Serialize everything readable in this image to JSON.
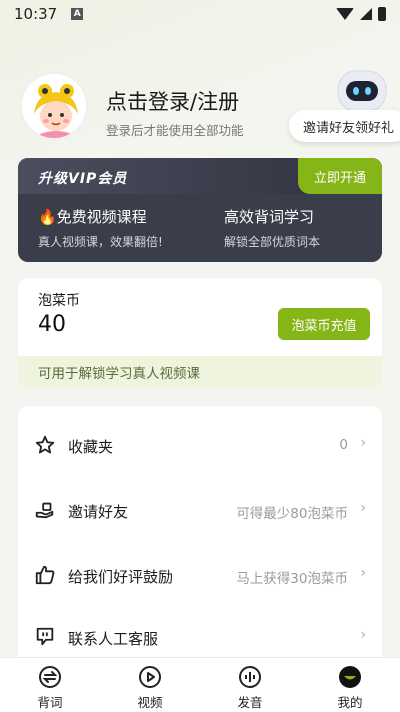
{
  "status_bar": {
    "time": "10:37",
    "notification_letter": "A"
  },
  "profile": {
    "title": "点击登录/注册",
    "subtitle": "登录后才能使用全部功能",
    "invite_pill": "邀请好友领好礼"
  },
  "vip": {
    "title": "升级VIP会员",
    "cta": "立即开通",
    "features": [
      {
        "title": "🔥免费视频课程",
        "subtitle": "真人视频课，效果翻倍!"
      },
      {
        "title": "高效背词学习",
        "subtitle": "解锁全部优质词本"
      }
    ]
  },
  "coins": {
    "label": "泡菜币",
    "value": "40",
    "button": "泡菜币充值",
    "note": "可用于解锁学习真人视频课"
  },
  "menu": [
    {
      "icon": "star-icon",
      "label": "收藏夹",
      "value": "0"
    },
    {
      "icon": "gift-hand-icon",
      "label": "邀请好友",
      "value": "可得最少80泡菜币"
    },
    {
      "icon": "thumbs-up-icon",
      "label": "给我们好评鼓励",
      "value": "马上获得30泡菜币"
    },
    {
      "icon": "chat-icon",
      "label": "联系人工客服",
      "value": ""
    }
  ],
  "tabs": [
    {
      "icon": "swap-icon",
      "label": "背词"
    },
    {
      "icon": "play-icon",
      "label": "视频"
    },
    {
      "icon": "audio-icon",
      "label": "发音"
    },
    {
      "icon": "smile-icon",
      "label": "我的"
    }
  ],
  "colors": {
    "accent": "#86b517",
    "vip_bg": "#3a3d4a"
  }
}
